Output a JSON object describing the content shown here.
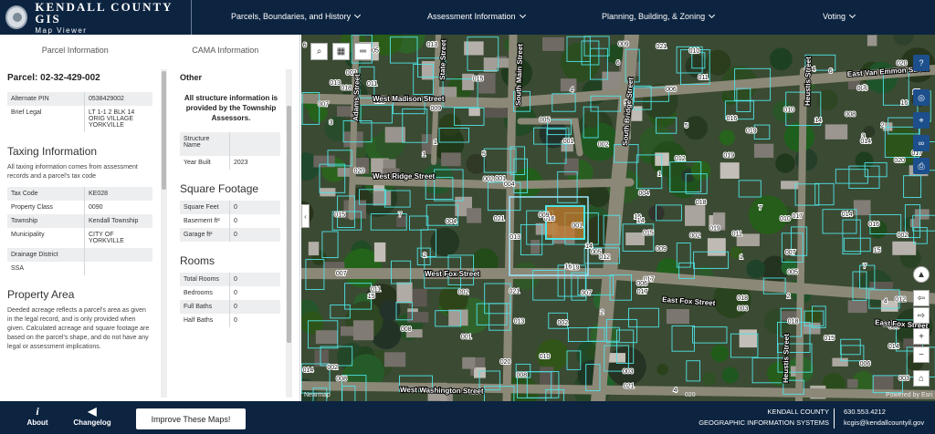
{
  "header": {
    "title": "KENDALL COUNTY GIS",
    "subtitle": "Map Viewer",
    "nav": [
      {
        "label": "Parcels, Boundaries, and History"
      },
      {
        "label": "Assessment Information"
      },
      {
        "label": "Planning, Building, & Zoning"
      },
      {
        "label": "Voting"
      }
    ]
  },
  "tabs": {
    "parcel": "Parcel Information",
    "cama": "CAMA Information"
  },
  "parcel": {
    "heading": "Parcel: 02-32-429-002",
    "fields": [
      {
        "label": "Alternate PIN",
        "value": "0538429002"
      },
      {
        "label": "Brief Legal",
        "value": "LT 1-1 2 BLK 14 ORIG VILLAGE YORKVILLE"
      }
    ]
  },
  "taxing": {
    "heading": "Taxing Information",
    "description": "All taxing information comes from assessment records and a parcel's tax code",
    "fields": [
      {
        "label": "Tax Code",
        "value": "KE028"
      },
      {
        "label": "Property Class",
        "value": "0090"
      },
      {
        "label": "Township",
        "value": "Kendall Township"
      },
      {
        "label": "Municipality",
        "value": "CITY OF YORKVILLE"
      },
      {
        "label": "Drainage District",
        "value": ""
      },
      {
        "label": "SSA",
        "value": ""
      }
    ]
  },
  "area": {
    "heading": "Property Area",
    "description": "Deeded acreage reflects a parcel's area as given in the legal record, and is only provided when given. Calculated acreage and square footage are based on the parcel's shape, and do not have any legal or assessment implications."
  },
  "cama": {
    "other_heading": "Other",
    "note": "All structure information is provided by the Township Assessors.",
    "structure": [
      {
        "label": "Structure Name",
        "value": ""
      },
      {
        "label": "Year Built",
        "value": "2023"
      }
    ],
    "sqft_heading": "Square Footage",
    "sqft": [
      {
        "label": "Square Feet",
        "value": "0"
      },
      {
        "label": "Basement ft²",
        "value": "0"
      },
      {
        "label": "Garage ft²",
        "value": "0"
      }
    ],
    "rooms_heading": "Rooms",
    "rooms": [
      {
        "label": "Total Rooms",
        "value": "0"
      },
      {
        "label": "Bedrooms",
        "value": "0"
      },
      {
        "label": "Full Baths",
        "value": "0"
      },
      {
        "label": "Half Baths",
        "value": "0"
      }
    ]
  },
  "map": {
    "streets": [
      {
        "name": "East Van Emmon Street"
      },
      {
        "name": "West Madison Street"
      },
      {
        "name": "Adams Street"
      },
      {
        "name": "State Street"
      },
      {
        "name": "South Main Street"
      },
      {
        "name": "South Bridge Street"
      },
      {
        "name": "Heustis Street"
      },
      {
        "name": "West Ridge Street"
      },
      {
        "name": "West Fox Street"
      },
      {
        "name": "East Fox Street"
      },
      {
        "name": "West Washington Street"
      }
    ],
    "labels": [
      "007",
      "008",
      "004",
      "003",
      "002",
      "001",
      "005",
      "006",
      "009",
      "010",
      "011",
      "012",
      "013",
      "014",
      "015",
      "016",
      "017",
      "018",
      "019",
      "020",
      "021",
      "002",
      "2",
      "1",
      "3",
      "4",
      "5",
      "6",
      "7",
      "15",
      "14",
      "16"
    ],
    "attrib_left": "Nearmap",
    "attrib_right": "Powered by Esri",
    "scale": "020"
  },
  "footer": {
    "about": "About",
    "changelog": "Changelog",
    "improve": "Improve These Maps!",
    "org_line1": "KENDALL COUNTY",
    "org_line2": "GEOGRAPHIC INFORMATION SYSTEMS",
    "phone": "630.553.4212",
    "email": "kcgis@kendallcountyil.gov"
  },
  "colors": {
    "navy": "#0c2440",
    "parcel_line": "#4fe3e6",
    "selected": "#c47a2c"
  }
}
